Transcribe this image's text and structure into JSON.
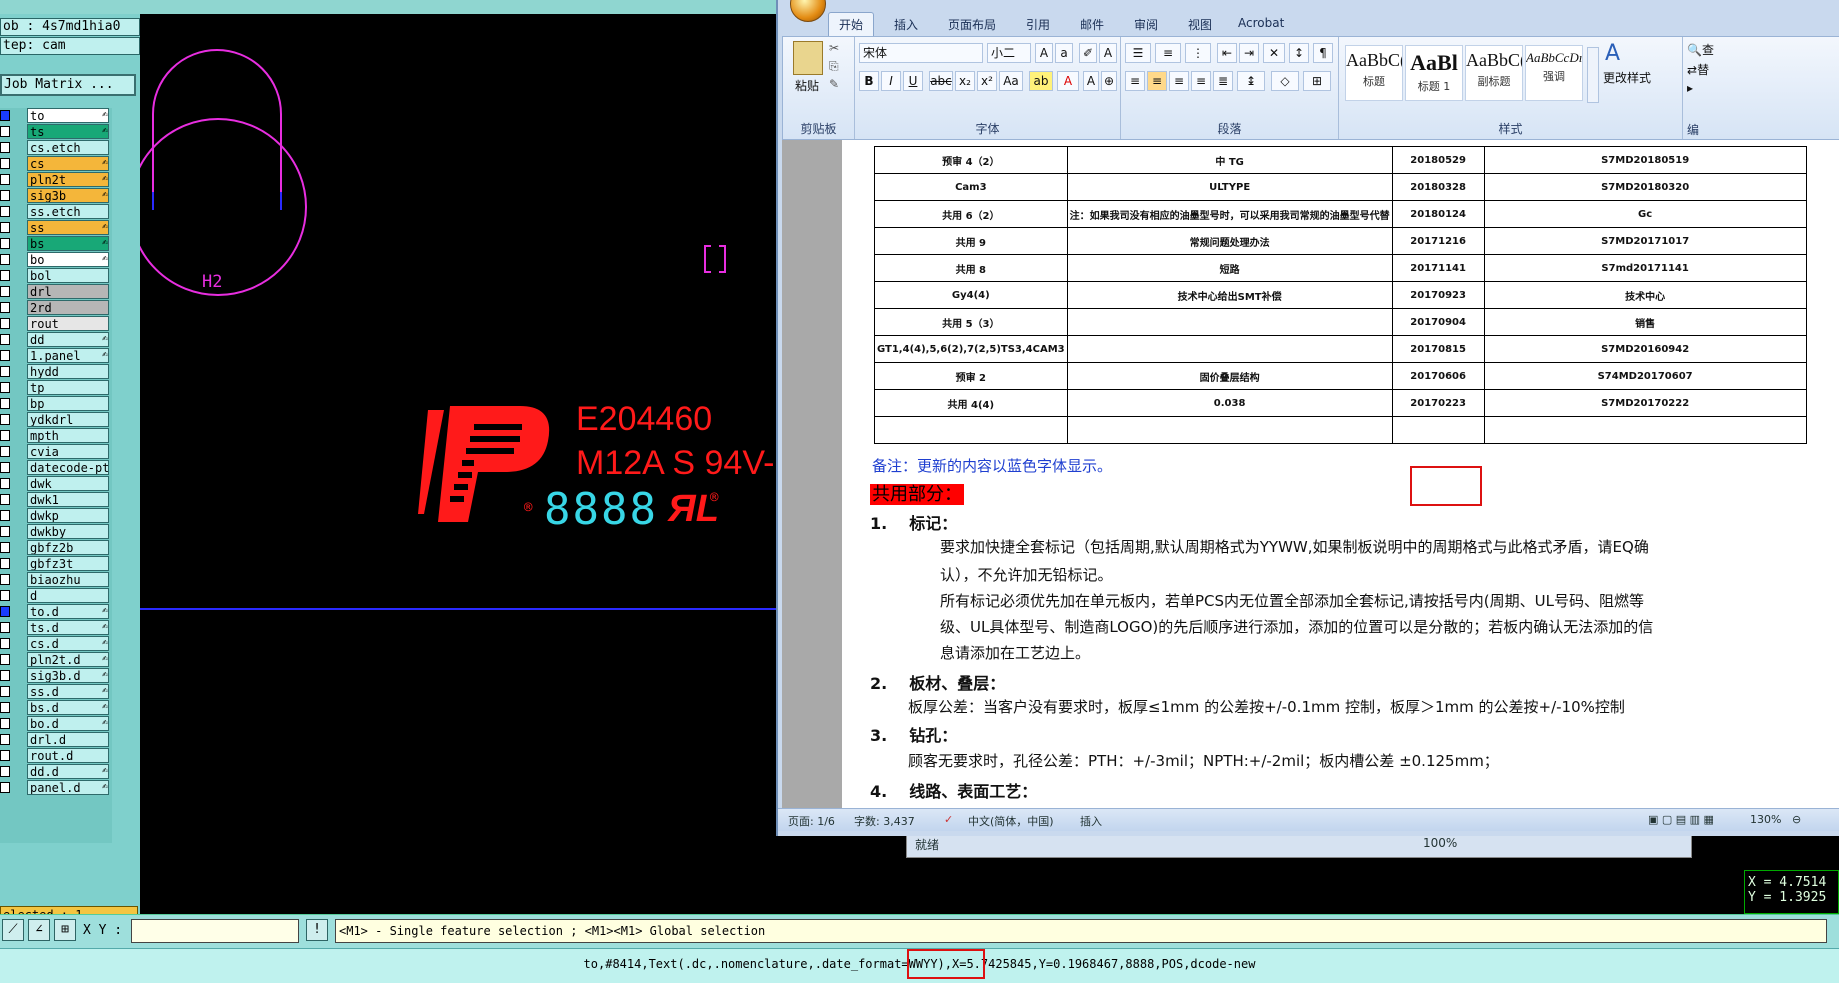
{
  "cam": {
    "job_label": "ob : 4s7md1hia0",
    "step_label": "tep: cam",
    "job_matrix_button": "Job Matrix ...",
    "layers": [
      {
        "name": "to",
        "color": "#ffffff",
        "edit": "✍",
        "check": "on"
      },
      {
        "name": "ts",
        "color": "#18a877",
        "edit": "✍",
        "check": "off"
      },
      {
        "name": "cs.etch",
        "color": "#bff0ee",
        "edit": "",
        "check": "off"
      },
      {
        "name": "cs",
        "color": "#f4b63a",
        "edit": "✍",
        "check": "off"
      },
      {
        "name": "pln2t",
        "color": "#f4b63a",
        "edit": "✍",
        "check": "off"
      },
      {
        "name": "sig3b",
        "color": "#f4b63a",
        "edit": "✍",
        "check": "off"
      },
      {
        "name": "ss.etch",
        "color": "#bff0ee",
        "edit": "",
        "check": "off"
      },
      {
        "name": "ss",
        "color": "#f4b63a",
        "edit": "✍",
        "check": "off"
      },
      {
        "name": "bs",
        "color": "#18a877",
        "edit": "✍",
        "check": "off"
      },
      {
        "name": "bo",
        "color": "#ffffff",
        "edit": "✍",
        "check": "off"
      },
      {
        "name": "bol",
        "color": "#bff0ee",
        "edit": "",
        "check": "off"
      },
      {
        "name": "drl",
        "color": "#b6b6b6",
        "edit": "",
        "check": "off"
      },
      {
        "name": "2rd",
        "color": "#b6b6b6",
        "edit": "",
        "check": "off"
      },
      {
        "name": "rout",
        "color": "#e6e6e6",
        "edit": "",
        "check": "off"
      },
      {
        "name": "dd",
        "color": "#bff0ee",
        "edit": "✍",
        "check": "off"
      },
      {
        "name": "1.panel",
        "color": "#bff0ee",
        "edit": "✍",
        "check": "off"
      },
      {
        "name": "hydd",
        "color": "#bff0ee",
        "edit": "",
        "check": "off"
      },
      {
        "name": "tp",
        "color": "#bff0ee",
        "edit": "",
        "check": "off"
      },
      {
        "name": "bp",
        "color": "#bff0ee",
        "edit": "",
        "check": "off"
      },
      {
        "name": "ydkdrl",
        "color": "#bff0ee",
        "edit": "",
        "check": "off"
      },
      {
        "name": "mpth",
        "color": "#bff0ee",
        "edit": "",
        "check": "off"
      },
      {
        "name": "cvia",
        "color": "#bff0ee",
        "edit": "",
        "check": "off"
      },
      {
        "name": "datecode-pte",
        "color": "#bff0ee",
        "edit": "",
        "check": "off"
      },
      {
        "name": "dwk",
        "color": "#bff0ee",
        "edit": "",
        "check": "off"
      },
      {
        "name": "dwk1",
        "color": "#bff0ee",
        "edit": "",
        "check": "off"
      },
      {
        "name": "dwkp",
        "color": "#bff0ee",
        "edit": "",
        "check": "off"
      },
      {
        "name": "dwkby",
        "color": "#bff0ee",
        "edit": "",
        "check": "off"
      },
      {
        "name": "gbfz2b",
        "color": "#bff0ee",
        "edit": "",
        "check": "off"
      },
      {
        "name": "gbfz3t",
        "color": "#bff0ee",
        "edit": "",
        "check": "off"
      },
      {
        "name": "biaozhu",
        "color": "#bff0ee",
        "edit": "",
        "check": "off"
      },
      {
        "name": "d",
        "color": "#bff0ee",
        "edit": "",
        "check": "off"
      },
      {
        "name": "to.d",
        "color": "#bff0ee",
        "edit": "✍",
        "check": "on"
      },
      {
        "name": "ts.d",
        "color": "#bff0ee",
        "edit": "✍",
        "check": "off"
      },
      {
        "name": "cs.d",
        "color": "#bff0ee",
        "edit": "✍",
        "check": "off"
      },
      {
        "name": "pln2t.d",
        "color": "#bff0ee",
        "edit": "✍",
        "check": "off"
      },
      {
        "name": "sig3b.d",
        "color": "#bff0ee",
        "edit": "✍",
        "check": "off"
      },
      {
        "name": "ss.d",
        "color": "#bff0ee",
        "edit": "✍",
        "check": "off"
      },
      {
        "name": "bs.d",
        "color": "#bff0ee",
        "edit": "✍",
        "check": "off"
      },
      {
        "name": "bo.d",
        "color": "#bff0ee",
        "edit": "✍",
        "check": "off"
      },
      {
        "name": "drl.d",
        "color": "#bff0ee",
        "edit": "",
        "check": "off"
      },
      {
        "name": "rout.d",
        "color": "#bff0ee",
        "edit": "",
        "check": "off"
      },
      {
        "name": "dd.d",
        "color": "#bff0ee",
        "edit": "✍",
        "check": "off"
      },
      {
        "name": "panel.d",
        "color": "#bff0ee",
        "edit": "✍",
        "check": "off"
      }
    ],
    "selected_label": "elected : 1",
    "canvas": {
      "label_h2": "H2",
      "ul_number": "E204460",
      "material": "M12A S 94V-",
      "date_digits": "8888",
      "reg_mark": "®",
      "ul_mark": "ЯL",
      "accent_magenta": "#e82ee0",
      "accent_red": "#ff1a1a",
      "accent_cyan": "#38d6e6",
      "line_blue": "#2a2aff"
    },
    "xy_label": "X Y :",
    "xy_value": "",
    "help_text": "<M1> - Single feature selection ; <M1><M1> Global selection",
    "status_text": "to,#8414,Text(.dc,.nomenclature,.date_format=WWYY),X=5.7425845,Y=0.1968467,8888,POS,dcode-new",
    "coord_x": "X = 4.7514",
    "coord_y": "Y = 1.3925"
  },
  "word": {
    "tabs": [
      "开始",
      "插入",
      "页面布局",
      "引用",
      "邮件",
      "审阅",
      "视图",
      "Acrobat"
    ],
    "active_tab": "开始",
    "clipboard_label": "剪贴板",
    "paste_label": "粘贴",
    "font_label": "字体",
    "font_name": "宋体",
    "font_size": "小二",
    "paragraph_label": "段落",
    "styles_label": "样式",
    "change_styles": "更改样式",
    "edit_label": "编",
    "find_label": "查",
    "replace_label": "替",
    "styles": [
      {
        "sample": "AaBbC(",
        "name": "标题"
      },
      {
        "sample": "AaBl",
        "name": "标题 1"
      },
      {
        "sample": "AaBbC(",
        "name": "副标题"
      },
      {
        "sample": "AaBbCcDı",
        "name": "强调"
      }
    ],
    "table_rows": [
      [
        "预审 4（2）",
        "中 TG",
        "20180529",
        "S7MD20180519"
      ],
      [
        "Cam3",
        "ULTYPE",
        "20180328",
        "S7MD20180320"
      ],
      [
        "共用 6（2）",
        "注：如果我司没有相应的油墨型号时，可以采用我司常规的油墨型号代替",
        "20180124",
        "Gc"
      ],
      [
        "共用 9",
        "常规问题处理办法",
        "20171216",
        "S7MD20171017"
      ],
      [
        "共用 8",
        "短路",
        "20171141",
        "S7md20171141"
      ],
      [
        "Gy4(4)",
        "技术中心给出SMT补偿",
        "20170923",
        "技术中心"
      ],
      [
        "共用 5（3）",
        "",
        "20170904",
        "销售"
      ],
      [
        "GT1,4(4),5,6(2),7(2,5)TS3,4CAM3",
        "",
        "20170815",
        "S7MD20160942"
      ],
      [
        "预审 2",
        "固价叠层结构",
        "20170606",
        "S74MD20170607"
      ],
      [
        "共用 4(4)",
        "0.038",
        "20170223",
        "S7MD20170222"
      ],
      [
        "",
        "",
        "",
        ""
      ]
    ],
    "note": "备注：更新的内容以蓝色字体显示。",
    "shared_title": "共用部分：",
    "sections": [
      {
        "num": "1.",
        "title": "标记："
      },
      {
        "num": "2.",
        "title": "板材、叠层："
      },
      {
        "num": "3.",
        "title": "钻孔："
      },
      {
        "num": "4.",
        "title": "线路、表面工艺："
      }
    ],
    "para1a": "要求加快捷全套标记（包括周期,默认周期格式为YYWW,如果制板说明中的周期格式与此格式矛盾，请EQ确",
    "para1b": "认），不允许加无铅标记。",
    "para1c": "所有标记必须优先加在单元板内，若单PCS内无位置全部添加全套标记,请按括号内(周期、UL号码、阻燃等",
    "para1d": "级、UL具体型号、制造商LOGO)的先后顺序进行添加，添加的位置可以是分散的；若板内确认无法添加的信",
    "para1e": "息请添加在工艺边上。",
    "para2": "板厚公差：当客户没有要求时，板厚≤1mm 的公差按+/-0.1mm 控制，板厚＞1mm 的公差按+/-10%控制",
    "para3": "顾客无要求时，孔径公差：PTH：+/-3mil；NPTH:+/-2mil；板内槽公差  ±0.125mm；",
    "status": {
      "page": "页面: 1/6",
      "words": "字数: 3,437",
      "lang": "中文(简体，中国)",
      "mode": "插入",
      "zoom": "130%"
    }
  },
  "excel_strip": {
    "ready": "就绪",
    "zoom": "100%"
  }
}
